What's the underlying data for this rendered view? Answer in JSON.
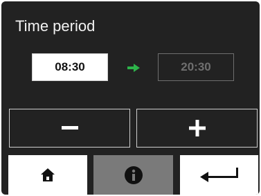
{
  "title": "Time period",
  "time_period": {
    "start": "08:30",
    "end": "20:30"
  },
  "icons": {
    "arrow": "arrow-right-icon",
    "minus": "minus-icon",
    "plus": "plus-icon",
    "home": "home-icon",
    "info": "info-icon",
    "back": "return-arrow-icon"
  },
  "colors": {
    "background": "#222222",
    "arrow": "#2db34a",
    "active_box": "#ffffff",
    "inactive_text": "#6f6f6f",
    "info_button": "#7a7a7a"
  }
}
